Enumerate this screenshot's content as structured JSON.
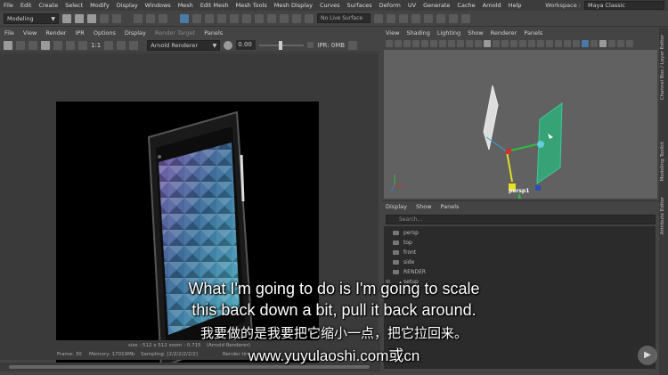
{
  "menubar": {
    "items": [
      "File",
      "Edit",
      "Create",
      "Select",
      "Modify",
      "Display",
      "Windows",
      "Mesh",
      "Edit Mesh",
      "Mesh Tools",
      "Mesh Display",
      "Curves",
      "Surfaces",
      "Deform",
      "UV",
      "Generate",
      "Cache",
      "Arnold",
      "Help"
    ],
    "workspace_label": "Workspace :",
    "workspace_value": "Maya Classic"
  },
  "shelf": {
    "mode": "Modeling",
    "live_surface": "No Live Surface"
  },
  "render_view": {
    "menu": [
      "File",
      "View",
      "Render",
      "IPR",
      "Options",
      "Display",
      "Render Target",
      "Panels"
    ],
    "ratio": "1:1",
    "renderer": "Arnold Renderer",
    "exposure": "0.00",
    "ipr_label": "IPR: 0MB",
    "status": {
      "size": "size : 512 x 512  zoom : 0.715",
      "arnold": "(Arnold Renderer)",
      "frame": "Frame: 30",
      "memory": "Memory: 17019Mb",
      "sampling": "Sampling: [2/2/2/2/2/2]",
      "render": "Render tim"
    }
  },
  "viewport": {
    "menu": [
      "View",
      "Shading",
      "Lighting",
      "Show",
      "Renderer",
      "Panels"
    ],
    "camera_label": "persp1"
  },
  "outliner": {
    "menu": [
      "Display",
      "Show",
      "Panels"
    ],
    "search_placeholder": "Search...",
    "rows": [
      "persp",
      "top",
      "front",
      "side",
      "RENDER",
      "setup",
      "",
      ""
    ]
  },
  "side_tabs": [
    "Channel Box / Layer Editor",
    "Modeling Toolkit",
    "Attribute Editor"
  ],
  "subtitles": {
    "en_line1": "What I'm going to do is I'm going to scale",
    "en_line2": "this back down a bit, pull it back around.",
    "zh_line": "我要做的是我要把它缩小一点，把它拉回来。",
    "url": "www.yuyulaoshi.com或cn"
  },
  "colors": {
    "accent": "#4a7aa8",
    "panel_bg": "#444444",
    "viewport_bg": "#616161"
  }
}
